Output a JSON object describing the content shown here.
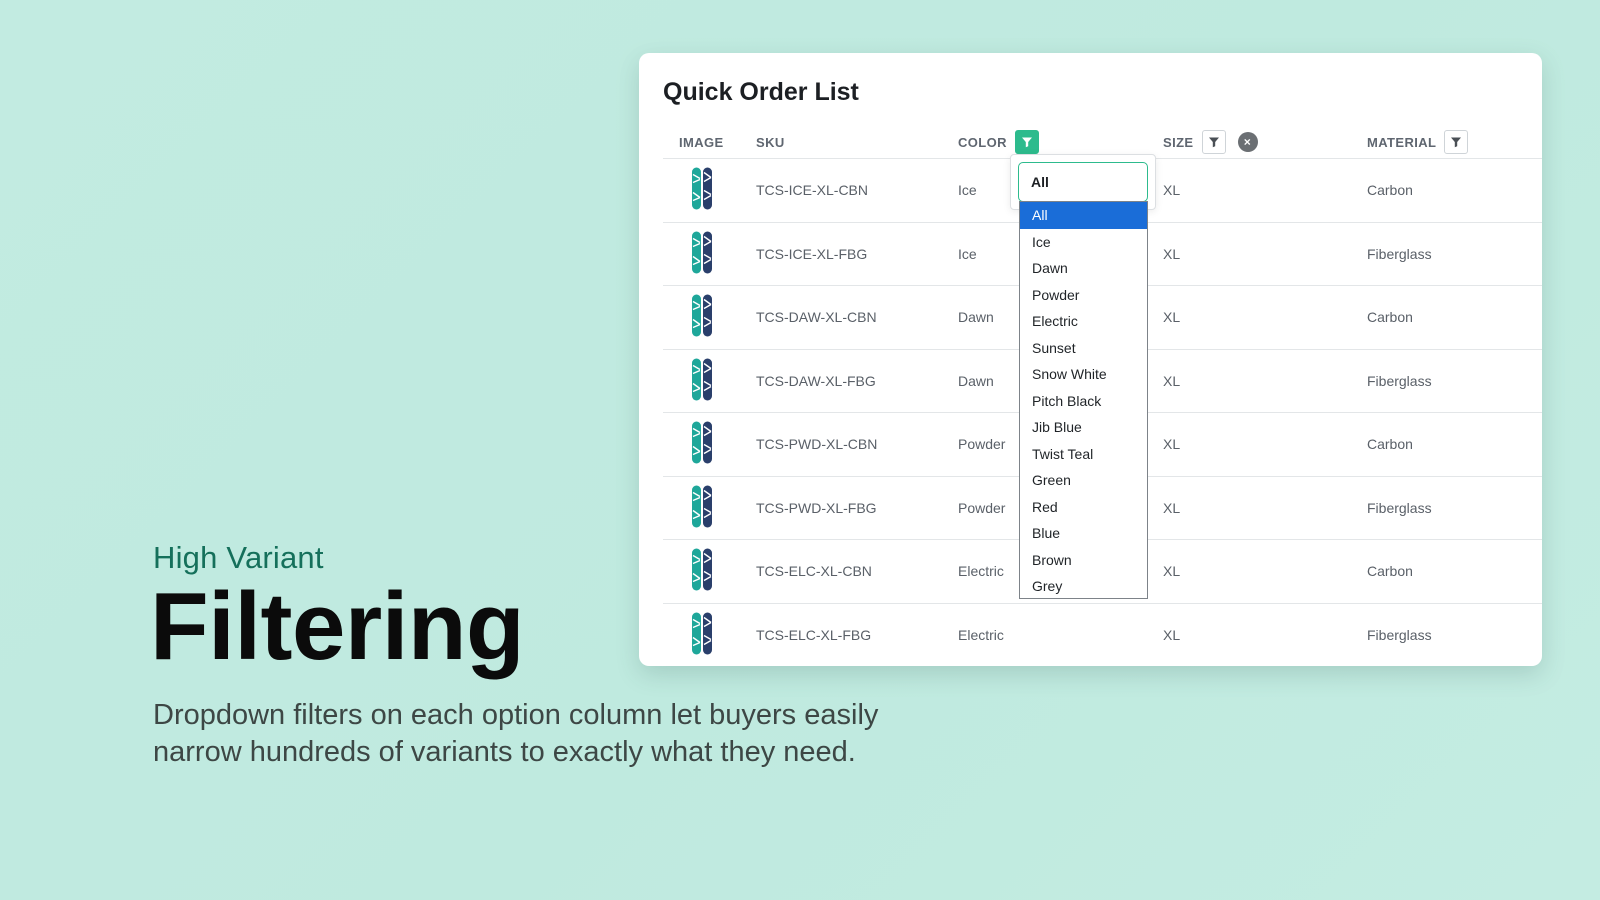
{
  "hero": {
    "kicker": "High Variant",
    "headline": "Filtering",
    "description": "Dropdown filters on each option column let buyers easily narrow hundreds of variants to exactly what they need."
  },
  "card": {
    "title": "Quick Order List",
    "columns": {
      "image": "IMAGE",
      "sku": "SKU",
      "color": "COLOR",
      "size": "SIZE",
      "material": "MATERIAL"
    },
    "rows": [
      {
        "sku": "TCS-ICE-XL-CBN",
        "color": "Ice",
        "size": "XL",
        "material": "Carbon"
      },
      {
        "sku": "TCS-ICE-XL-FBG",
        "color": "Ice",
        "size": "XL",
        "material": "Fiberglass"
      },
      {
        "sku": "TCS-DAW-XL-CBN",
        "color": "Dawn",
        "size": "XL",
        "material": "Carbon"
      },
      {
        "sku": "TCS-DAW-XL-FBG",
        "color": "Dawn",
        "size": "XL",
        "material": "Fiberglass"
      },
      {
        "sku": "TCS-PWD-XL-CBN",
        "color": "Powder",
        "size": "XL",
        "material": "Carbon"
      },
      {
        "sku": "TCS-PWD-XL-FBG",
        "color": "Powder",
        "size": "XL",
        "material": "Fiberglass"
      },
      {
        "sku": "TCS-ELC-XL-CBN",
        "color": "Electric",
        "size": "XL",
        "material": "Carbon"
      },
      {
        "sku": "TCS-ELC-XL-FBG",
        "color": "Electric",
        "size": "XL",
        "material": "Fiberglass"
      }
    ]
  },
  "color_filter": {
    "selected_value": "All",
    "options": [
      "All",
      "Ice",
      "Dawn",
      "Powder",
      "Electric",
      "Sunset",
      "Snow White",
      "Pitch Black",
      "Jib Blue",
      "Twist Teal",
      "Green",
      "Red",
      "Blue",
      "Brown",
      "Grey"
    ],
    "highlighted_option": "All"
  },
  "size_filter": {
    "clear_icon": "×"
  },
  "colors": {
    "accent": "#2dbb8d",
    "selected_option": "#1a6dd8",
    "kicker": "#15705b"
  }
}
